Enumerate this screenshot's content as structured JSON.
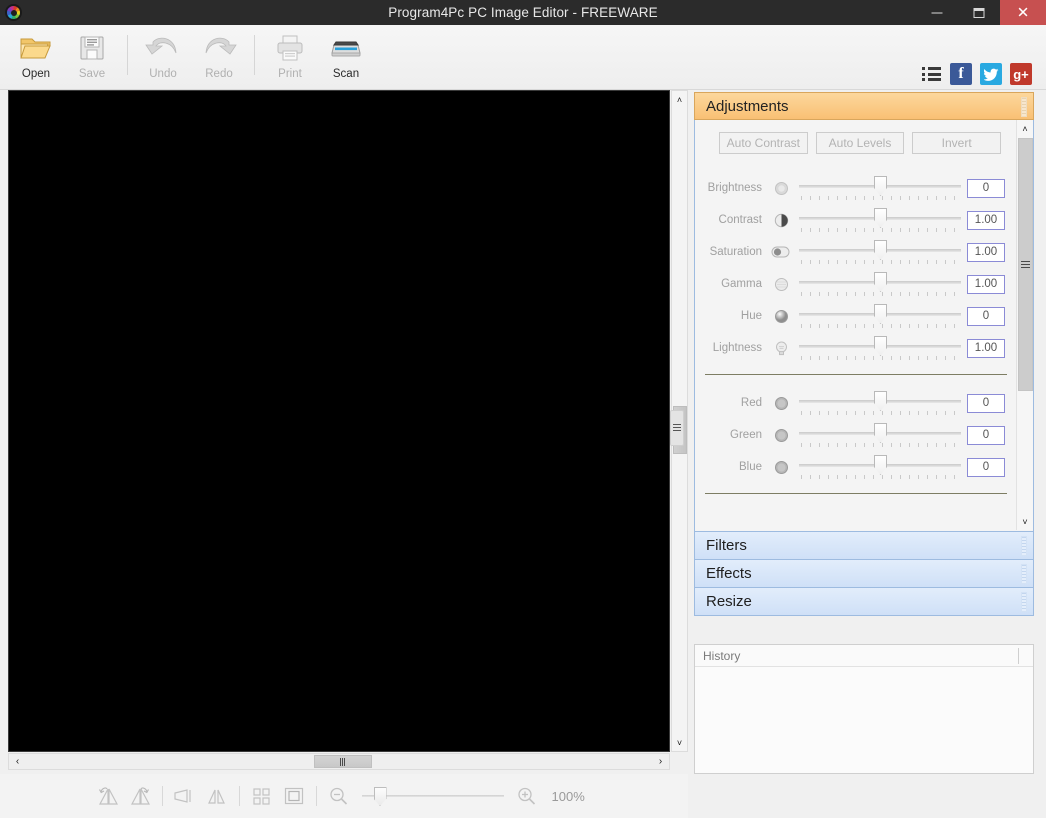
{
  "window": {
    "title": "Program4Pc PC Image Editor - FREEWARE",
    "app_icon": "color-wheel-icon",
    "minimize_label": "",
    "maximize_label": "",
    "close_label": "✕",
    "close_color": "#c75050",
    "titlebar_color": "#2b2b2b"
  },
  "toolbar": {
    "items": [
      {
        "label": "Open",
        "icon": "folder-open-icon",
        "enabled": true
      },
      {
        "label": "Save",
        "icon": "floppy-disk-icon",
        "enabled": false
      },
      {
        "label": "Undo",
        "icon": "undo-arrow-icon",
        "enabled": false
      },
      {
        "label": "Redo",
        "icon": "redo-arrow-icon",
        "enabled": false
      },
      {
        "label": "Print",
        "icon": "printer-icon",
        "enabled": false
      },
      {
        "label": "Scan",
        "icon": "scanner-icon",
        "enabled": true
      }
    ],
    "right_icons": [
      {
        "name": "menu-list-icon",
        "label": ""
      },
      {
        "name": "facebook-icon",
        "label": "f",
        "color": "#3b5998"
      },
      {
        "name": "twitter-icon",
        "label": "🐦",
        "color": "#29a9e1"
      },
      {
        "name": "google-plus-icon",
        "label": "g+",
        "color": "#c0392b"
      }
    ]
  },
  "canvas": {
    "background_color": "#000000",
    "vertical_scrollbar": {
      "up": "˄",
      "down": "˅"
    },
    "horizontal_scrollbar": {
      "left": "‹",
      "right": "›"
    }
  },
  "bottom_toolbar": {
    "buttons": [
      {
        "name": "rotate-left-icon",
        "label": ""
      },
      {
        "name": "rotate-right-icon",
        "label": ""
      },
      {
        "name": "flip-horizontal-icon",
        "label": ""
      },
      {
        "name": "flip-vertical-icon",
        "label": ""
      },
      {
        "name": "tile-grid-icon",
        "label": ""
      },
      {
        "name": "fit-to-screen-icon",
        "label": ""
      },
      {
        "name": "zoom-out-icon",
        "label": ""
      },
      {
        "name": "zoom-in-icon",
        "label": ""
      }
    ],
    "zoom_level": "100%",
    "zoom_slider_value": 0
  },
  "panels": {
    "adjustments": {
      "title": "Adjustments",
      "expanded": true,
      "header_color": "#f9c074",
      "auto_buttons": [
        {
          "label": "Auto Contrast",
          "enabled": false
        },
        {
          "label": "Auto Levels",
          "enabled": false
        },
        {
          "label": "Invert",
          "enabled": false
        }
      ],
      "sliders_group1": [
        {
          "label": "Brightness",
          "icon": "sun-icon",
          "value": "0",
          "thumb_pct": 50
        },
        {
          "label": "Contrast",
          "icon": "contrast-icon",
          "value": "1.00",
          "thumb_pct": 50
        },
        {
          "label": "Saturation",
          "icon": "saturation-icon",
          "value": "1.00",
          "thumb_pct": 50
        },
        {
          "label": "Gamma",
          "icon": "gamma-icon",
          "value": "1.00",
          "thumb_pct": 50
        },
        {
          "label": "Hue",
          "icon": "hue-sphere-icon",
          "value": "0",
          "thumb_pct": 50
        },
        {
          "label": "Lightness",
          "icon": "lightbulb-icon",
          "value": "1.00",
          "thumb_pct": 50
        }
      ],
      "sliders_group2": [
        {
          "label": "Red",
          "icon": "red-channel-icon",
          "value": "0",
          "thumb_pct": 50
        },
        {
          "label": "Green",
          "icon": "green-channel-icon",
          "value": "0",
          "thumb_pct": 50
        },
        {
          "label": "Blue",
          "icon": "blue-channel-icon",
          "value": "0",
          "thumb_pct": 50
        }
      ],
      "scrollbar": {
        "up": "˄",
        "down": "˅"
      }
    },
    "collapsed_panels": [
      {
        "title": "Filters"
      },
      {
        "title": "Effects"
      },
      {
        "title": "Resize"
      }
    ],
    "history": {
      "title": "History",
      "items": []
    }
  }
}
